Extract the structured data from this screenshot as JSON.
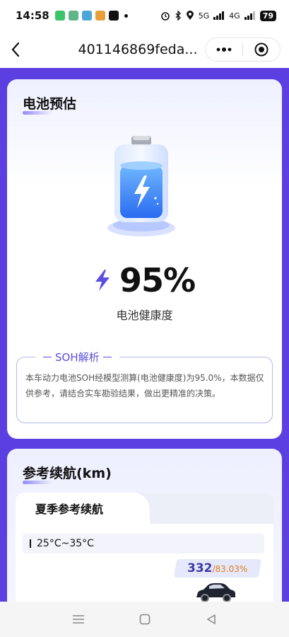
{
  "status_bar": {
    "time": "14:58",
    "network": "5G",
    "network2": "4G",
    "battery": "79"
  },
  "nav": {
    "title": "401146869feda...",
    "more_icon": "more-dots-icon",
    "target_icon": "record-circle-icon"
  },
  "battery_section": {
    "title": "电池预估",
    "percent": "95%",
    "label": "电池健康度",
    "soh_title": "SOH解析",
    "soh_text": "本车动力电池SOH经模型测算(电池健康度)为95.0%，本数据仅供参考，请结合实车勘验结果，做出更精准的决策。"
  },
  "range_section": {
    "title": "参考续航(km)",
    "tab_label": "夏季参考续航",
    "temp_range": "25°C~35°C",
    "range_value": "332",
    "range_percent": "/83.03%"
  },
  "colors": {
    "accent": "#5b3fe0",
    "soh_border": "#b4b8ea",
    "range_value": "#3b3aa8",
    "range_percent": "#e07c1a"
  }
}
